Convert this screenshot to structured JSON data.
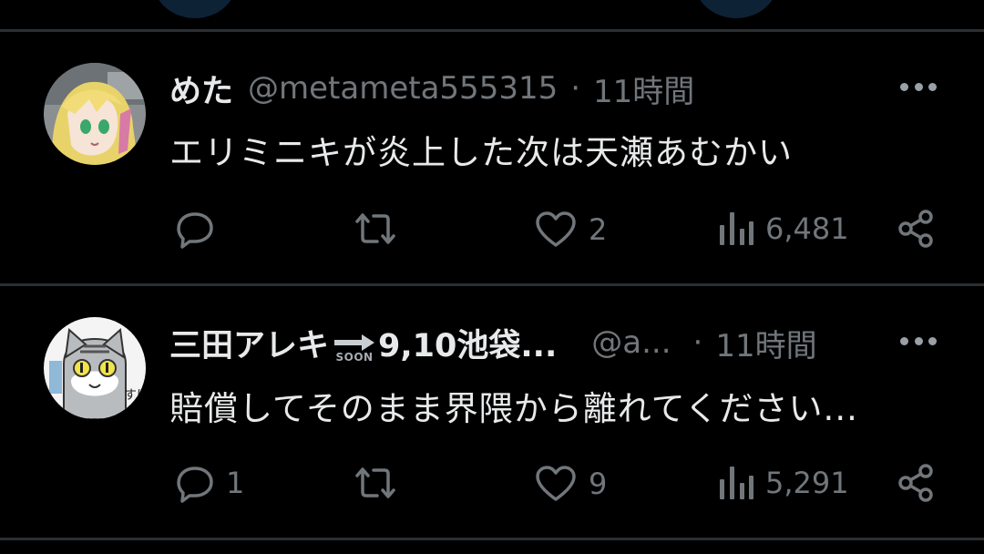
{
  "tweets": [
    {
      "display_name": "めた",
      "handle": "@metameta555315",
      "separator": "·",
      "time": "11時間",
      "text": "エリミニキが炎上した次は天瀬あむかい",
      "reply_count": "",
      "retweet_count": "",
      "like_count": "2",
      "view_count": "6,481"
    },
    {
      "display_name_pre": "三田アレキ",
      "soon_label": "SOON",
      "display_name_post": "9,10池袋...",
      "handle": "@a...",
      "separator": "·",
      "time": "11時間",
      "text": "賠償してそのまま界隈から離れてください...",
      "reply_count": "1",
      "retweet_count": "",
      "like_count": "9",
      "view_count": "5,291"
    }
  ],
  "colors": {
    "background": "#000000",
    "text": "#e7e9ea",
    "muted": "#71767b",
    "divider": "#2a2f33"
  },
  "icons": [
    "more-icon",
    "reply-icon",
    "retweet-icon",
    "like-icon",
    "views-icon",
    "share-icon",
    "soon-arrow-icon"
  ]
}
